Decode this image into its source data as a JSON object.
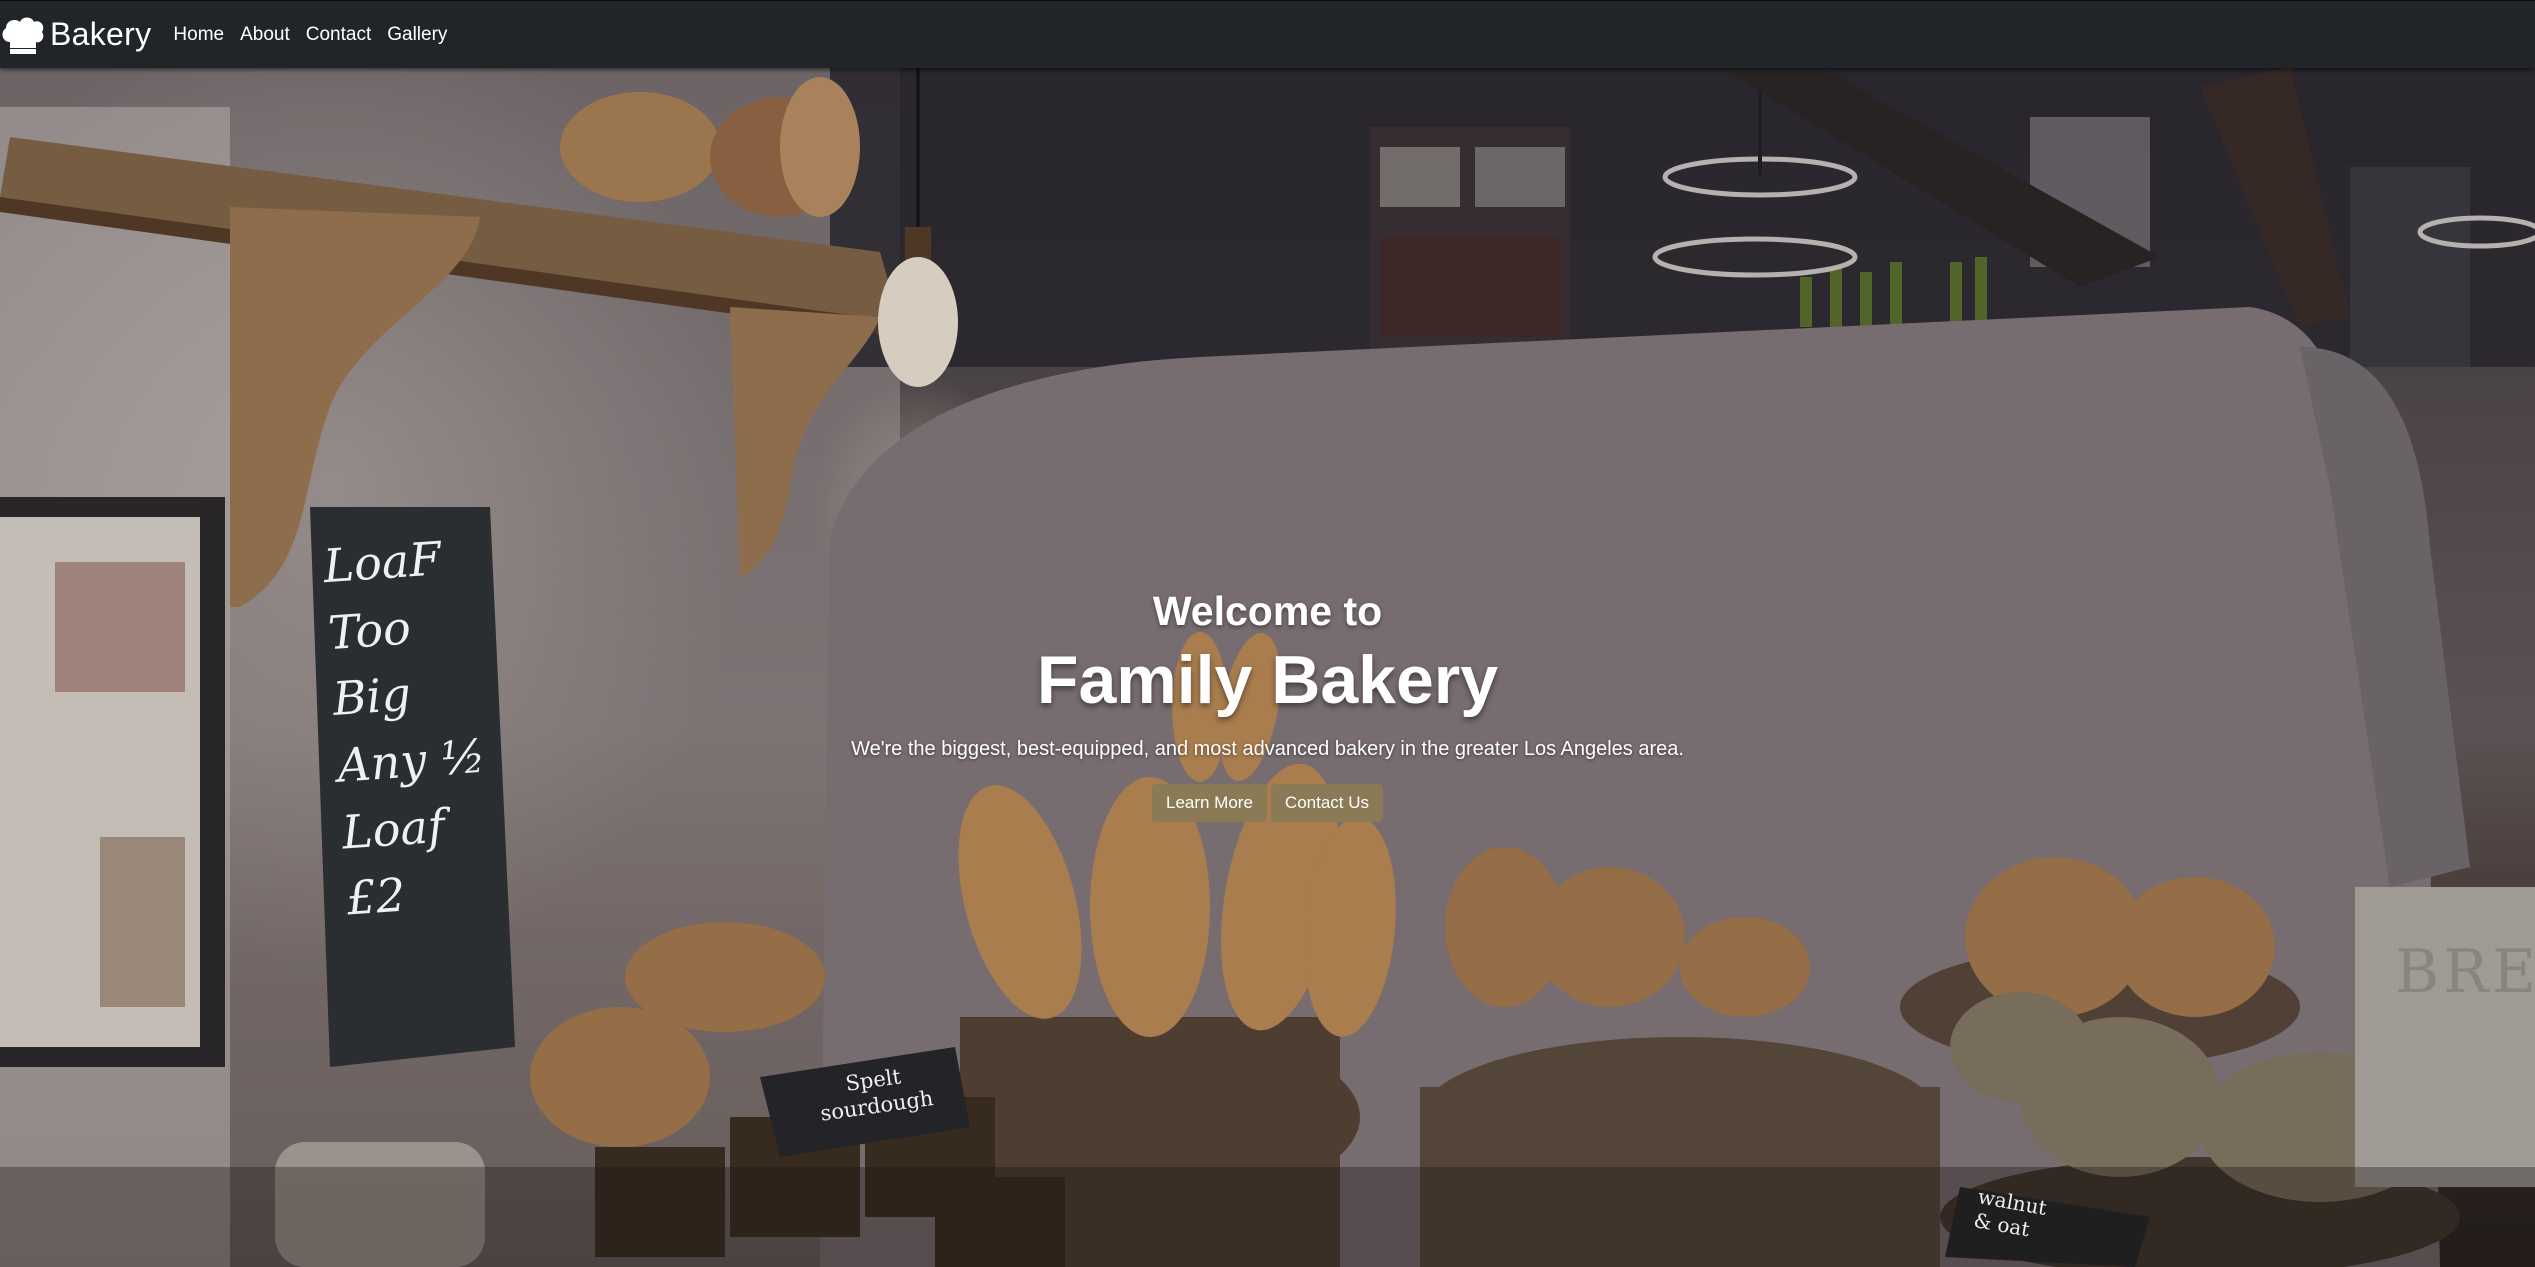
{
  "navbar": {
    "brand": "Bakery",
    "brand_icon": "chef-hat-icon",
    "links": [
      "Home",
      "About",
      "Contact",
      "Gallery"
    ]
  },
  "hero": {
    "subtitle": "Welcome to",
    "title": "Family Bakery",
    "lead": "We're the biggest, best-equipped, and most advanced bakery in the greater Los Angeles area.",
    "buttons": [
      "Learn More",
      "Contact Us"
    ],
    "chalkboard_text": [
      "LoaF Too",
      "Big",
      "Any ½",
      "Loaf £2"
    ],
    "sign_1": [
      "Spelt",
      "sourdough"
    ],
    "sign_2": [
      "walnut",
      "& oat"
    ],
    "bin_text": "BRE"
  },
  "colors": {
    "navbar_bg": "#212529",
    "button_bg": "#8a7a55",
    "text": "#ffffff"
  }
}
